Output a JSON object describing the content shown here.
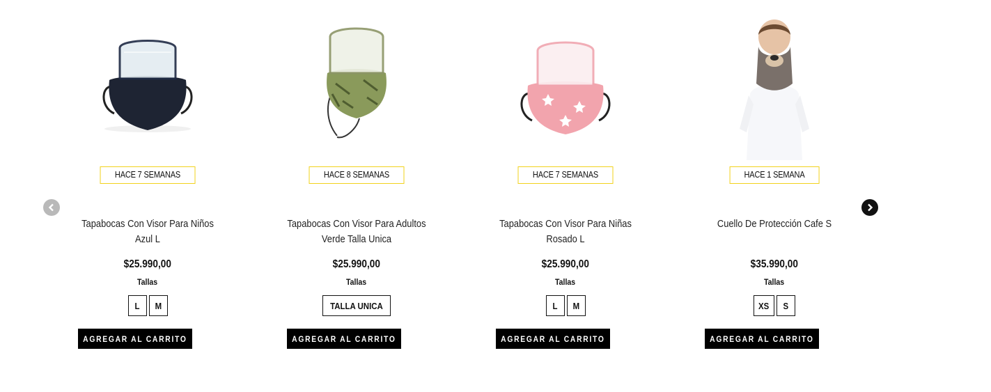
{
  "carousel": {
    "prev_icon": "chevron-left-icon",
    "next_icon": "chevron-right-icon",
    "colors": {
      "accent_border": "#f2d21b",
      "button_bg": "#000000",
      "button_text": "#ffffff",
      "prev_bg": "#b9b9b9",
      "next_bg": "#111111"
    }
  },
  "products": [
    {
      "badge": "HACE 7 SEMANAS",
      "name": "Tapabocas Con Visor Para Niños Azul L",
      "price": "$25.990,00",
      "sizes_label": "Tallas",
      "sizes": [
        "L",
        "M"
      ],
      "cart_label": "AGREGAR AL CARRITO",
      "image": "navy-face-mask-with-visor"
    },
    {
      "badge": "HACE 8 SEMANAS",
      "name": "Tapabocas Con Visor Para Adultos Verde Talla Unica",
      "price": "$25.990,00",
      "sizes_label": "Tallas",
      "sizes": [
        "TALLA UNICA"
      ],
      "cart_label": "AGREGAR AL CARRITO",
      "image": "green-leaf-face-mask-with-visor"
    },
    {
      "badge": "HACE 7 SEMANAS",
      "name": "Tapabocas Con Visor Para Niñas Rosado L",
      "price": "$25.990,00",
      "sizes_label": "Tallas",
      "sizes": [
        "L",
        "M"
      ],
      "cart_label": "AGREGAR AL CARRITO",
      "image": "pink-star-face-mask-with-visor"
    },
    {
      "badge": "HACE 1 SEMANA",
      "name": "Cuello De Protección Cafe S",
      "price": "$35.990,00",
      "sizes_label": "Tallas",
      "sizes": [
        "XS",
        "S"
      ],
      "cart_label": "AGREGAR AL CARRITO",
      "image": "child-wearing-brown-neck-gaiter"
    }
  ]
}
